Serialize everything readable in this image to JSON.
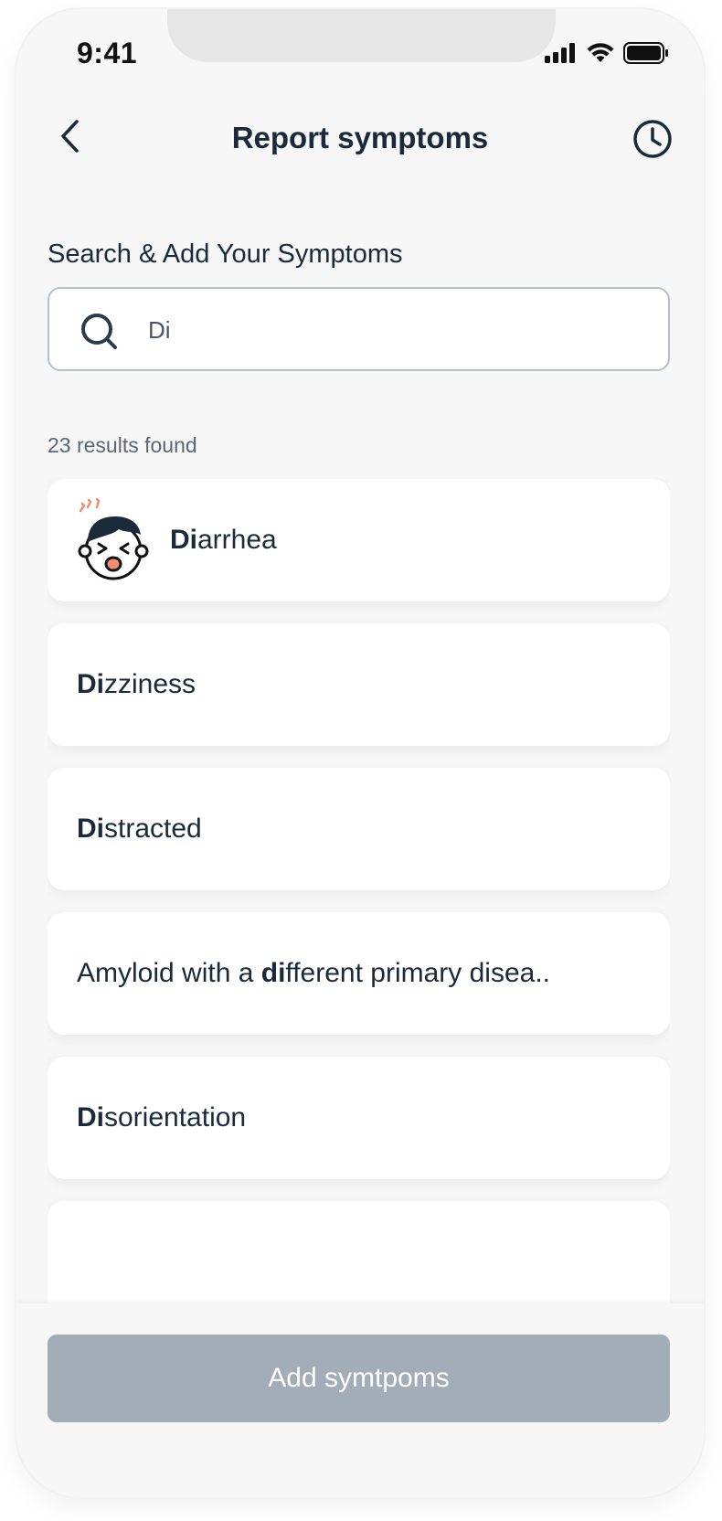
{
  "status_bar": {
    "time": "9:41",
    "icons": [
      "signal-icon",
      "wifi-icon",
      "battery-icon"
    ]
  },
  "header": {
    "title": "Report symptoms",
    "back_icon": "chevron-left-icon",
    "history_icon": "clock-icon"
  },
  "search": {
    "label": "Search & Add Your Symptoms",
    "value": "Di",
    "icon": "search-icon"
  },
  "results": {
    "count_text": "23 results found",
    "items": [
      {
        "before": "",
        "match": "Di",
        "after": "arrhea",
        "has_avatar": true
      },
      {
        "before": "",
        "match": "Di",
        "after": "zziness",
        "has_avatar": false
      },
      {
        "before": "",
        "match": "Di",
        "after": "stracted",
        "has_avatar": false
      },
      {
        "before": "Amyloid with a ",
        "match": "di",
        "after": "fferent primary disea..",
        "has_avatar": false
      },
      {
        "before": "",
        "match": "Di",
        "after": "sorientation",
        "has_avatar": false
      },
      {
        "before": "",
        "match": "",
        "after": "",
        "has_avatar": false
      }
    ]
  },
  "footer": {
    "button_label": "Add symtpoms"
  },
  "colors": {
    "text_primary": "#1b2a3a",
    "button_disabled": "#a3adb8",
    "background": "#f7f7f7",
    "avatar_accent": "#f28b74"
  }
}
